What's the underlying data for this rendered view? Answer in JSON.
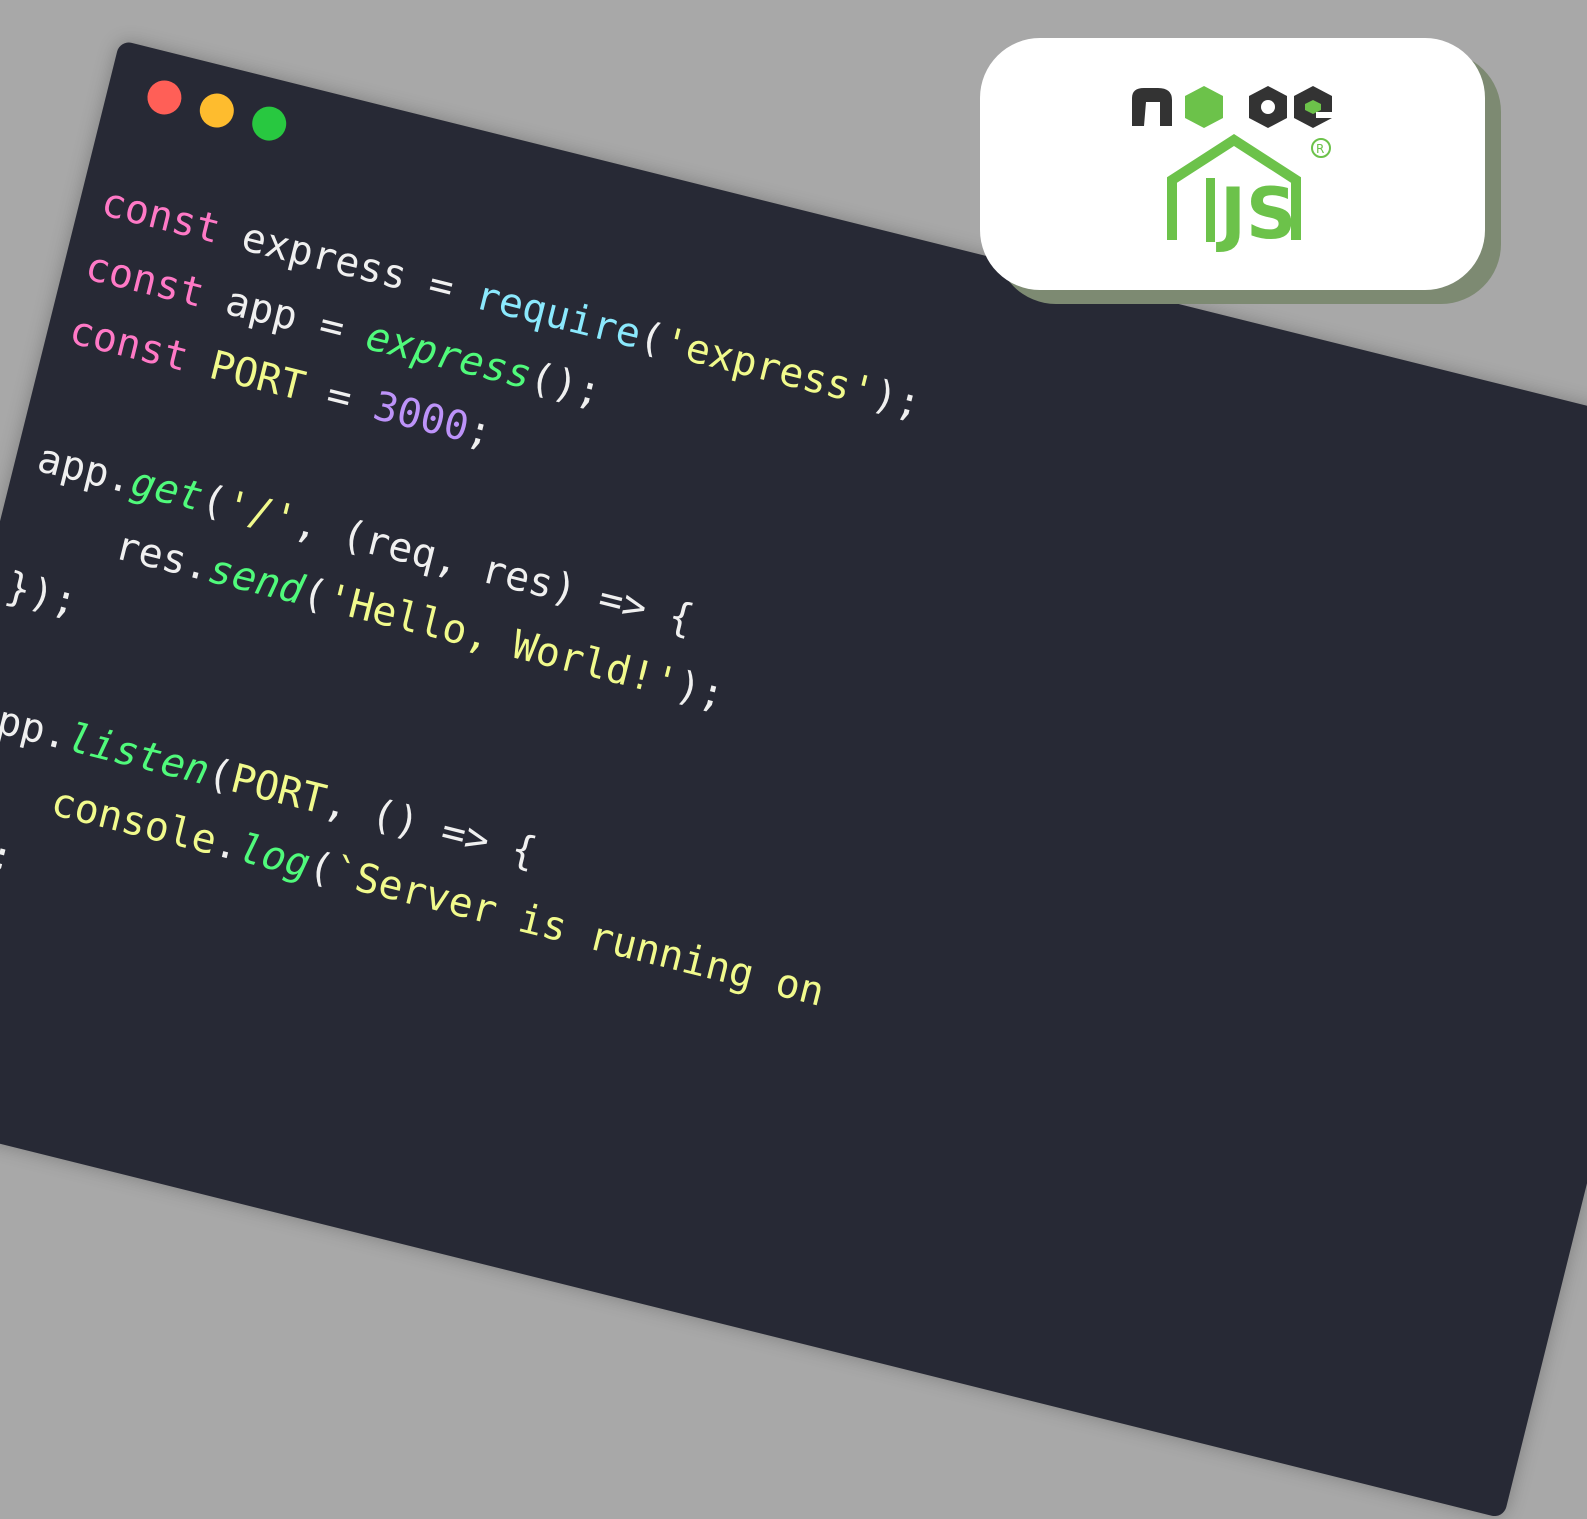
{
  "window": {
    "traffic_lights": [
      {
        "name": "close",
        "color": "#ff5f57"
      },
      {
        "name": "minimize",
        "color": "#febc2e"
      },
      {
        "name": "maximize",
        "color": "#28c840"
      }
    ]
  },
  "code": {
    "lines": [
      [
        {
          "t": "const",
          "c": "kw"
        },
        {
          "t": " express = ",
          "c": "plain"
        },
        {
          "t": "require",
          "c": "fn-blue"
        },
        {
          "t": "(",
          "c": "plain"
        },
        {
          "t": "'express'",
          "c": "str"
        },
        {
          "t": ");",
          "c": "plain"
        }
      ],
      [
        {
          "t": "const",
          "c": "kw"
        },
        {
          "t": " app = ",
          "c": "plain"
        },
        {
          "t": "express",
          "c": "fn-green"
        },
        {
          "t": "();",
          "c": "plain"
        }
      ],
      [
        {
          "t": "const",
          "c": "kw"
        },
        {
          "t": " ",
          "c": "plain"
        },
        {
          "t": "PORT",
          "c": "id-yellow"
        },
        {
          "t": " = ",
          "c": "plain"
        },
        {
          "t": "3000",
          "c": "num"
        },
        {
          "t": ";",
          "c": "plain"
        }
      ],
      [],
      [
        {
          "t": "app.",
          "c": "plain"
        },
        {
          "t": "get",
          "c": "fn-green"
        },
        {
          "t": "(",
          "c": "plain"
        },
        {
          "t": "'/'",
          "c": "str"
        },
        {
          "t": ", (req, res) => {",
          "c": "plain"
        }
      ],
      [
        {
          "t": "    res.",
          "c": "plain"
        },
        {
          "t": "send",
          "c": "fn-green"
        },
        {
          "t": "(",
          "c": "plain"
        },
        {
          "t": "'Hello, World!'",
          "c": "str"
        },
        {
          "t": ");",
          "c": "plain"
        }
      ],
      [
        {
          "t": "});",
          "c": "plain"
        }
      ],
      [],
      [
        {
          "t": "app.",
          "c": "plain"
        },
        {
          "t": "listen",
          "c": "fn-green"
        },
        {
          "t": "(",
          "c": "plain"
        },
        {
          "t": "PORT",
          "c": "id-yellow"
        },
        {
          "t": ", () => {",
          "c": "plain"
        }
      ],
      [
        {
          "t": "    ",
          "c": "plain"
        },
        {
          "t": "console",
          "c": "id-yellow"
        },
        {
          "t": ".",
          "c": "plain"
        },
        {
          "t": "log",
          "c": "fn-green"
        },
        {
          "t": "(",
          "c": "plain"
        },
        {
          "t": "`Server is running on ",
          "c": "str"
        }
      ],
      [
        {
          "t": "});",
          "c": "plain"
        }
      ]
    ]
  },
  "logo": {
    "text": "node",
    "sub": "JS",
    "trademark": "®",
    "colors": {
      "dark": "#333333",
      "green": "#6cc24a"
    }
  }
}
